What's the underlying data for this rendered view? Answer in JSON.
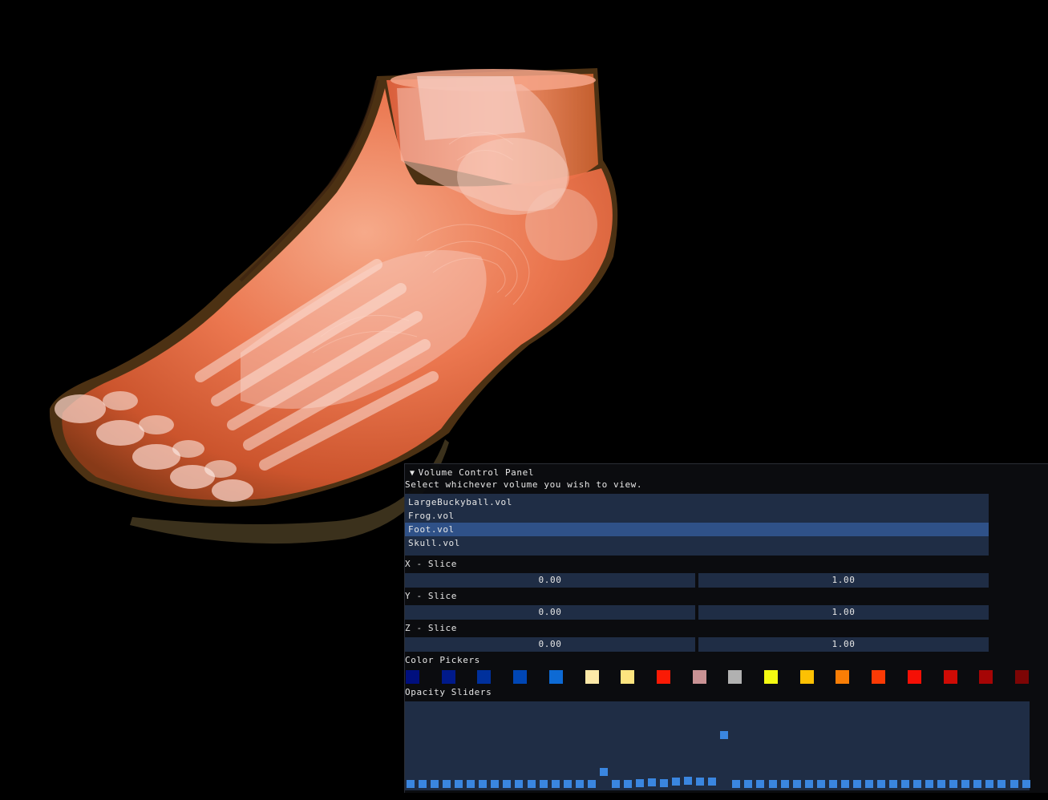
{
  "panel": {
    "title": "Volume Control Panel",
    "instruction": "Select whichever volume you wish to view.",
    "volumes": [
      "LargeBuckyball.vol",
      "Frog.vol",
      "Foot.vol",
      "Skull.vol"
    ],
    "selected_volume": "Foot.vol",
    "slices": [
      {
        "label": "X - Slice",
        "min": "0.00",
        "max": "1.00"
      },
      {
        "label": "Y - Slice",
        "min": "0.00",
        "max": "1.00"
      },
      {
        "label": "Z - Slice",
        "min": "0.00",
        "max": "1.00"
      }
    ],
    "color_pickers_label": "Color Pickers",
    "color_pickers": [
      "#000f7e",
      "#001a8a",
      "#00309c",
      "#0046b4",
      "#0d6ad4",
      "#fde9a8",
      "#fde47f",
      "#fa1a05",
      "#c99294",
      "#b1b1b1",
      "#f4fa12",
      "#fdc103",
      "#f97e06",
      "#fb3a05",
      "#f50f05",
      "#cf0b05",
      "#a50505",
      "#7d0505"
    ],
    "opacity_sliders_label": "Opacity Sliders",
    "opacity_values": [
      0.05,
      0.05,
      0.05,
      0.05,
      0.05,
      0.05,
      0.05,
      0.05,
      0.05,
      0.05,
      0.05,
      0.05,
      0.05,
      0.05,
      0.05,
      0.05,
      0.2,
      0.05,
      0.05,
      0.06,
      0.07,
      0.06,
      0.08,
      0.09,
      0.08,
      0.08,
      0.65,
      0.05,
      0.05,
      0.05,
      0.05,
      0.05,
      0.05,
      0.05,
      0.05,
      0.05,
      0.05,
      0.05,
      0.05,
      0.05,
      0.05,
      0.05,
      0.05,
      0.05,
      0.05,
      0.05,
      0.05,
      0.05,
      0.05,
      0.05,
      0.05,
      0.05
    ]
  }
}
